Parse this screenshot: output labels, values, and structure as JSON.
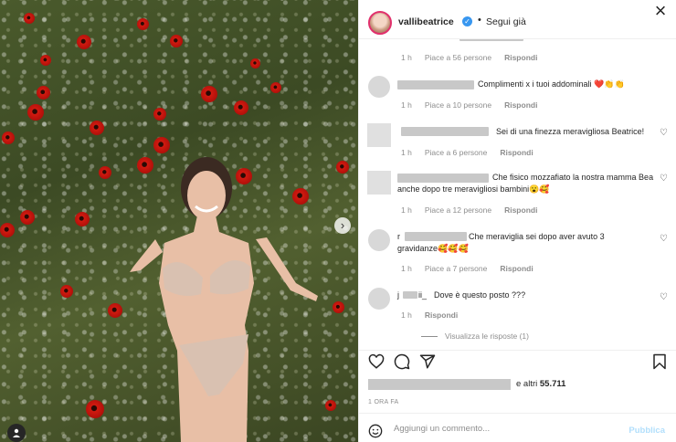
{
  "post": {
    "username": "vallibeatrice",
    "verified_symbol": "✓",
    "separator": "•",
    "follow_label": "Segui già",
    "close_symbol": "×",
    "next_arrow": "›"
  },
  "comments": [
    {
      "text": "",
      "time": "1 h",
      "likes": "Piace a 56 persone",
      "reply": "Rispondi"
    },
    {
      "text": "Complimenti x i tuoi addominali ❤️👏👏",
      "time": "1 h",
      "likes": "Piace a 10 persone",
      "reply": "Rispondi"
    },
    {
      "text": "Sei di una finezza meravigliosa Beatrice!",
      "time": "1 h",
      "likes": "Piace a 6 persone",
      "reply": "Rispondi"
    },
    {
      "text": "Che fisico mozzafiato la nostra mamma Bea anche dopo tre meravigliosi bambini😮🥰",
      "time": "1 h",
      "likes": "Piace a 12 persone",
      "reply": "Rispondi"
    },
    {
      "user_prefix": "r",
      "text": "Che meraviglia sei dopo aver avuto 3 gravidanze🥰🥰🥰",
      "time": "1 h",
      "likes": "Piace a 7 persone",
      "reply": "Rispondi"
    },
    {
      "user_prefix": "j",
      "user_suffix": "ii_",
      "text": "Dove è questo posto ???",
      "time": "1 h",
      "reply": "Rispondi",
      "view_replies": "Visualizza le risposte (1)"
    }
  ],
  "likes_summary": {
    "prefix": "e altri",
    "count": "55.711"
  },
  "timestamp": "1 ORA FA",
  "comment_box": {
    "placeholder": "Aggiungi un commento...",
    "publish_label": "Pubblica"
  },
  "icons": {
    "like": "heart-icon",
    "comment": "comment-icon",
    "share": "share-icon",
    "save": "bookmark-icon",
    "emoji": "emoji-icon"
  }
}
